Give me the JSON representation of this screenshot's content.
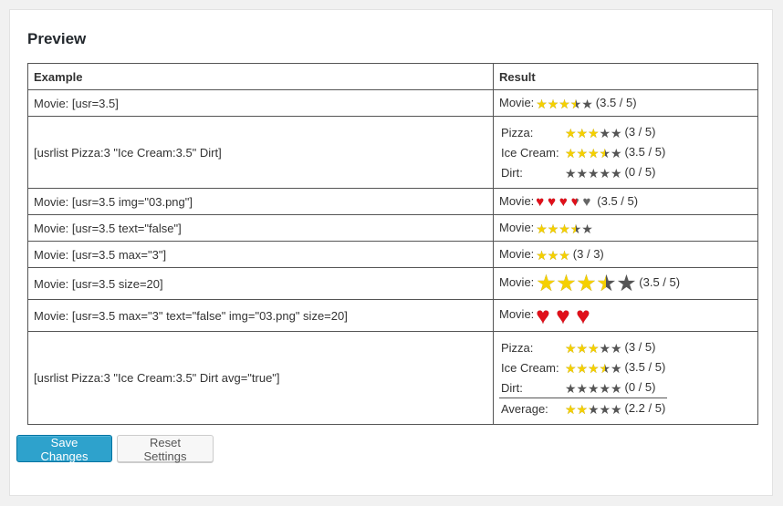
{
  "preview": {
    "heading": "Preview",
    "columns": {
      "example": "Example",
      "result": "Result"
    },
    "rows": [
      {
        "example": "Movie: [usr=3.5]",
        "label": "Movie:",
        "rating": 3.5,
        "max": 5,
        "style": "star",
        "size": "sm",
        "score": "(3.5 / 5)"
      },
      {
        "example": "[usrlist Pizza:3 \"Ice Cream:3.5\" Dirt]",
        "list": [
          {
            "label": "Pizza:",
            "rating": 3,
            "max": 5,
            "score": "(3 / 5)"
          },
          {
            "label": "Ice Cream:",
            "rating": 3.5,
            "max": 5,
            "score": "(3.5 / 5)"
          },
          {
            "label": "Dirt:",
            "rating": 0,
            "max": 5,
            "score": "(0 / 5)"
          }
        ]
      },
      {
        "example": "Movie: [usr=3.5 img=\"03.png\"]",
        "label": "Movie:",
        "rating": 3.5,
        "max": 5,
        "style": "heart",
        "size": "sm",
        "score": "(3.5 / 5)"
      },
      {
        "example": "Movie: [usr=3.5 text=\"false\"]",
        "label": "Movie:",
        "rating": 3.5,
        "max": 5,
        "style": "star",
        "size": "sm",
        "score": ""
      },
      {
        "example": "Movie: [usr=3.5 max=\"3\"]",
        "label": "Movie:",
        "rating": 3,
        "max": 3,
        "style": "star",
        "size": "sm",
        "score": "(3 / 3)"
      },
      {
        "example": "Movie: [usr=3.5 size=20]",
        "label": "Movie:",
        "rating": 3.5,
        "max": 5,
        "style": "star",
        "size": "lg",
        "score": "(3.5 / 5)"
      },
      {
        "example": "Movie: [usr=3.5 max=\"3\" text=\"false\" img=\"03.png\" size=20]",
        "label": "Movie:",
        "rating": 3,
        "max": 3,
        "style": "heart",
        "size": "lg",
        "score": ""
      },
      {
        "example": "[usrlist Pizza:3 \"Ice Cream:3.5\" Dirt avg=\"true\"]",
        "list": [
          {
            "label": "Pizza:",
            "rating": 3,
            "max": 5,
            "score": "(3 / 5)"
          },
          {
            "label": "Ice Cream:",
            "rating": 3.5,
            "max": 5,
            "score": "(3.5 / 5)"
          },
          {
            "label": "Dirt:",
            "rating": 0,
            "max": 5,
            "score": "(0 / 5)"
          },
          {
            "label": "Average:",
            "rating": 2.2,
            "max": 5,
            "score": "(2.2 / 5)"
          }
        ]
      }
    ]
  },
  "buttons": {
    "save": "Save Changes",
    "reset": "Reset Settings"
  },
  "icons": {
    "star": "star-icon",
    "heart": "heart-icon"
  },
  "colors": {
    "star_fill": "#f5d000",
    "star_empty": "#555555",
    "heart_fill": "#e0101a",
    "primary": "#2ea2cc"
  }
}
